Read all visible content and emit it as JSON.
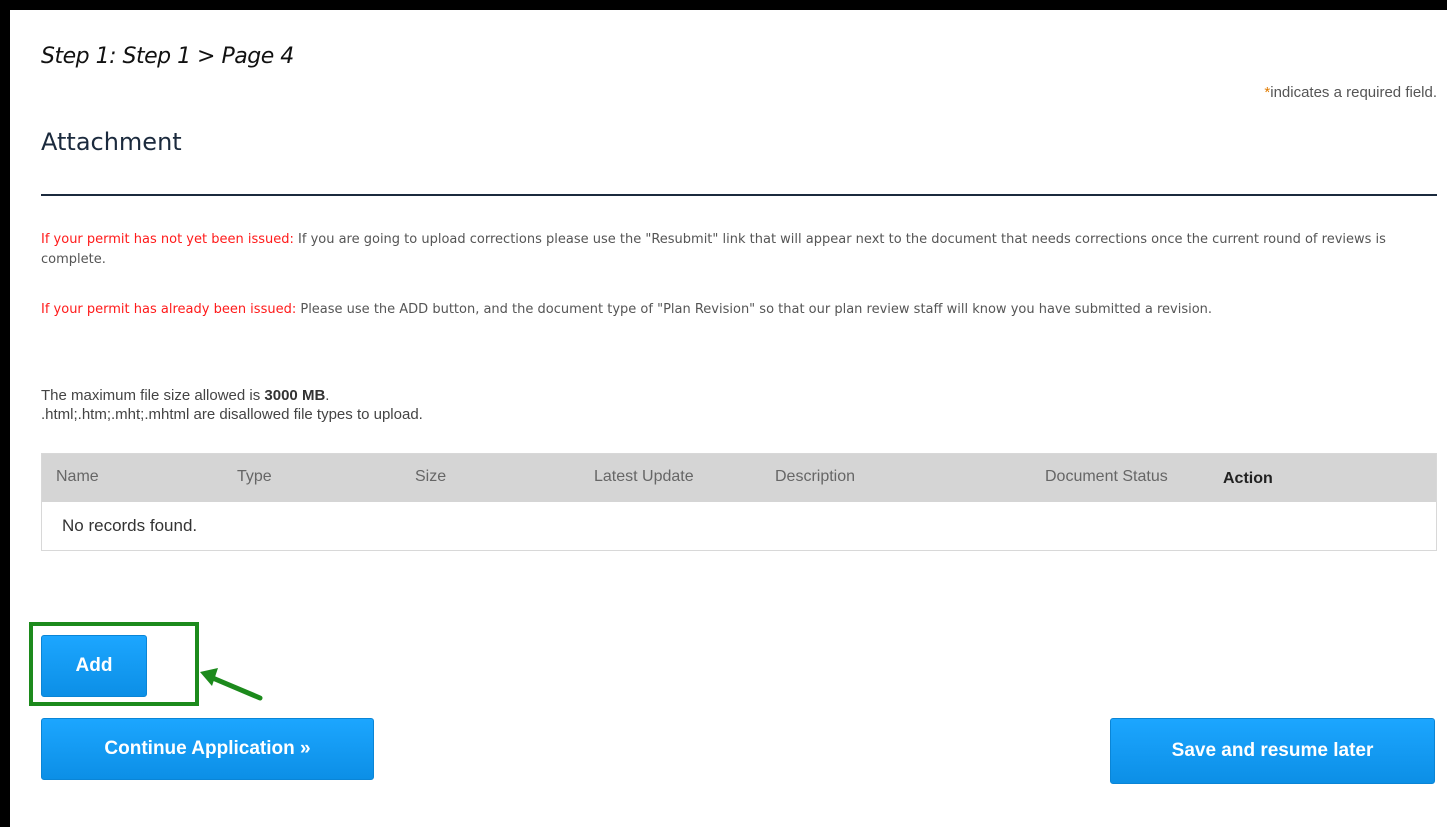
{
  "header": {
    "step_title": "Step 1: Step 1 > Page 4",
    "required_star": "*",
    "required_note": "indicates a required field."
  },
  "section": {
    "title": "Attachment"
  },
  "notices": [
    {
      "lead": "If your permit has not yet been issued:",
      "text": " If you are going to upload corrections please use the \"Resubmit\" link that will appear next to the document that needs corrections once the current round of reviews is complete."
    },
    {
      "lead": "If your permit has already been issued:",
      "text": " Please use the ADD button, and the document type of \"Plan Revision\" so that our plan review staff will know you have submitted a revision."
    }
  ],
  "file_info": {
    "max_size_prefix": "The maximum file size allowed is ",
    "max_size_value": "3000 MB",
    "max_size_suffix": ".",
    "disallowed": ".html;.htm;.mht;.mhtml are disallowed file types to upload."
  },
  "table": {
    "columns": [
      "Name",
      "Type",
      "Size",
      "Latest Update",
      "Description",
      "Document Status",
      "Action"
    ],
    "empty_message": "No records found."
  },
  "buttons": {
    "add": "Add",
    "continue": "Continue Application »",
    "save": "Save and resume later"
  },
  "colors": {
    "button_blue": "#1ca6ff",
    "highlight_green": "#1c8a1c",
    "notice_red": "#ff1a1a"
  }
}
